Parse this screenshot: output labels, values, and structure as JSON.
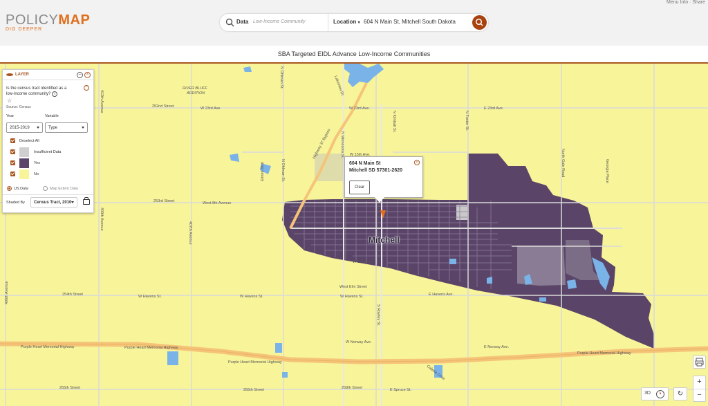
{
  "header": {
    "logo_main": "POLICY",
    "logo_main_bold": "MAP",
    "logo_tag": "DIG DEEPER",
    "top_right_links": "Menu Info · Share",
    "search": {
      "data_label": "Data",
      "data_placeholder": "Low-Income Community",
      "location_label": "Location",
      "location_value": "604 N Main St, Mitchell South Dakota"
    }
  },
  "map_title": "SBA Targeted EIDL Advance Low-Income Communities",
  "layer_panel": {
    "title": "LAYER",
    "question": "Is the census tract identified as a low-income community?",
    "source": "Source: Census",
    "year_label": "Year",
    "year_value": "2015-2019",
    "variable_label": "Variable",
    "variable_value": "Type",
    "deselect_all": "Deselect All",
    "legend": [
      {
        "label": "Insufficient Data",
        "color": "#cfcfcf"
      },
      {
        "label": "Yes",
        "color": "#5a4569"
      },
      {
        "label": "No",
        "color": "#f8f49a"
      }
    ],
    "us_data": "US Data",
    "map_extent_data": "Map Extent Data",
    "shaded_by_label": "Shaded By",
    "shaded_by_value": "Census Tract, 2010"
  },
  "popup": {
    "line1": "604 N Main St",
    "line2": "Mitchell SD 57301-2620",
    "clear": "Clear"
  },
  "map_labels": {
    "city": "Mitchell",
    "river_bluff": "RIVER BLUFF",
    "addition": "ADDITION",
    "w_252nd": "252nd Street",
    "w_23rd_a": "W 23rd Ave.",
    "w_23rd_b": "W 23rd Ave.",
    "e_23rd": "E 23rd Ave.",
    "w_15th": "W 15th Ave.",
    "w_253rd": "253rd Street",
    "west_8th": "West 8th Avenue",
    "w_cedar": "W Cedar Ave.",
    "west_elm": "West Elm Street",
    "w_havens_a": "254th Street",
    "w_havens_b": "W Havens St.",
    "w_havens_c": "W Havens St.",
    "w_havens_d": "W Havens St.",
    "e_havens": "E Havens Ave.",
    "w_norway": "W Norway Ave.",
    "e_norway": "E Norway Ave.",
    "purple_heart_a": "Purple Heart Memorial Highway",
    "purple_heart_b": "Purple Heart Memorial Highway",
    "purple_heart_c": "Purple Heart Memorial Highway",
    "purple_heart_d": "Purple Heart Memorial Highway",
    "w_255th": "255th Street",
    "w_255th_b": "255th Street",
    "e_spruce": "E Spruce St.",
    "w_258th": "258th Street",
    "ave_412": "412th Avenue",
    "ave_409": "409th Avenue",
    "ave_406": "406th Avenue",
    "ave_407": "407th Avenue",
    "n_ohlman": "N Ohlman St.",
    "n_ohlman2": "N Ohlman St.",
    "elmira": "Elmira Blvd",
    "hwy37": "Highway 37 Bypass",
    "n_minnesota": "N Minnesota St.",
    "n_kimball": "N Kimball St.",
    "n_foster": "N Foster St.",
    "north_gale": "North Gale Road",
    "georgia": "Georgia Place",
    "s_rowley": "S Rowley St.",
    "cabela": "Cabela Drive",
    "lakeview": "Lakeview Dr."
  },
  "controls": {
    "zoom_in": "+",
    "zoom_out": "−",
    "three_d": "3D"
  },
  "colors": {
    "yes": "#5a4569",
    "no": "#f8f49a",
    "insufficient": "#cfcfcf",
    "accent": "#a8561f",
    "highway": "#f5c47a",
    "water": "#7ab3e8"
  }
}
